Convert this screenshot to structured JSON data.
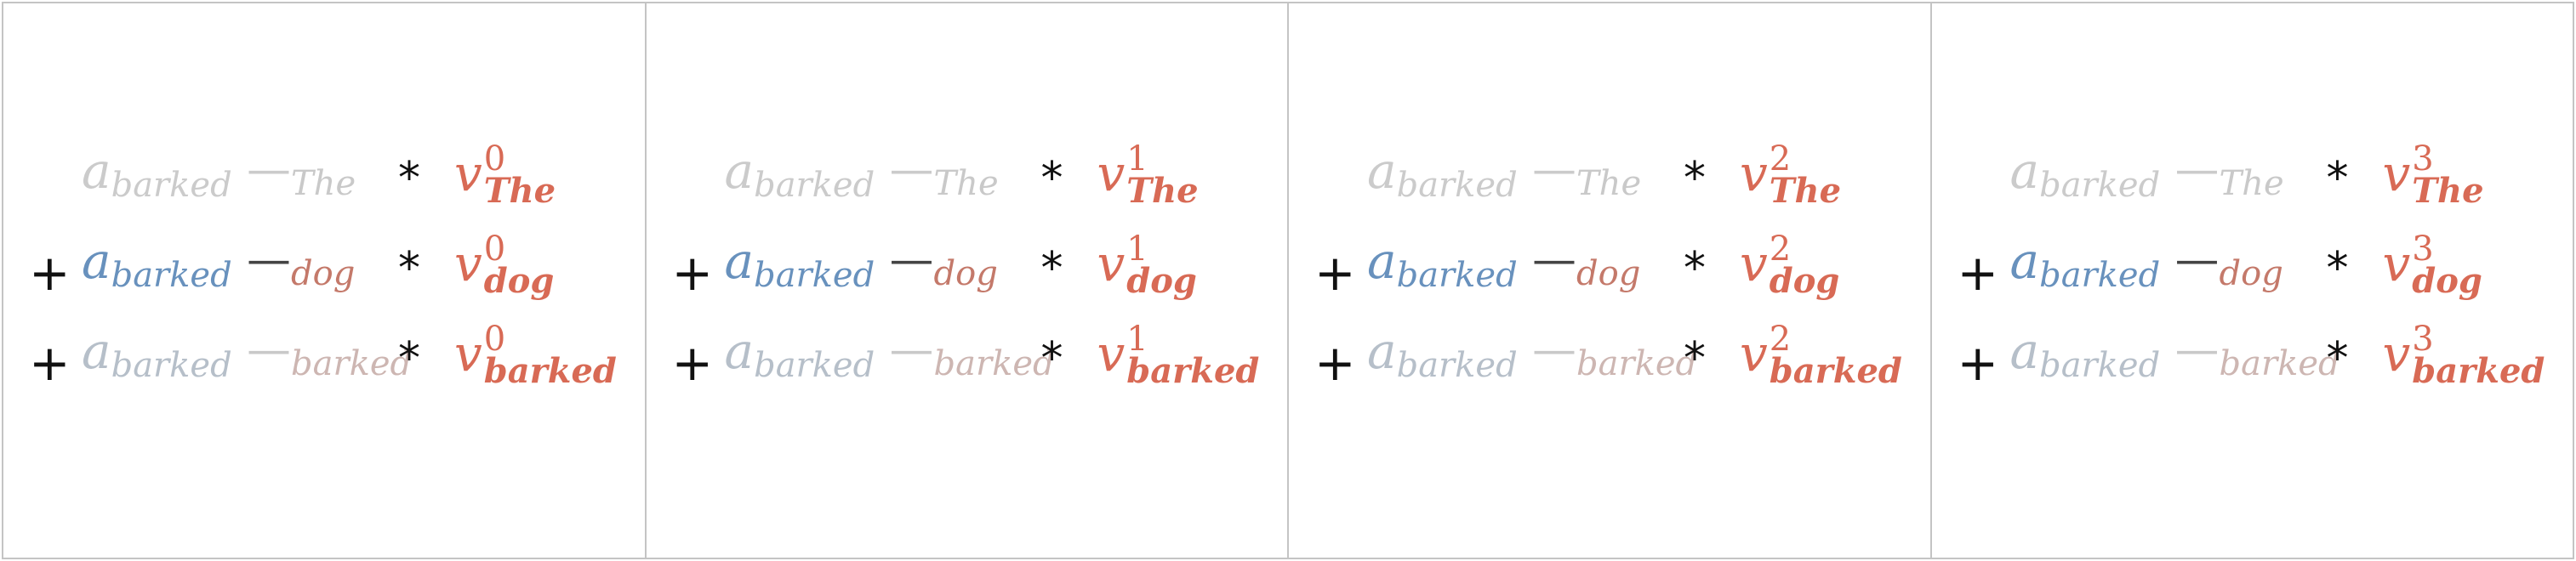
{
  "symbols": {
    "plus": "+",
    "times": "*",
    "minus": "—",
    "attention_base": "a",
    "value_base": "v"
  },
  "query": "barked",
  "panels": [
    {
      "index": "0",
      "rows": [
        {
          "lead": "",
          "a_sub": "barked",
          "key": "The",
          "v_sup": "0",
          "v_sub": "The"
        },
        {
          "lead": "+",
          "a_sub": "barked",
          "key": "dog",
          "v_sup": "0",
          "v_sub": "dog"
        },
        {
          "lead": "+",
          "a_sub": "barked",
          "key": "barked",
          "v_sup": "0",
          "v_sub": "barked"
        }
      ]
    },
    {
      "index": "1",
      "rows": [
        {
          "lead": "",
          "a_sub": "barked",
          "key": "The",
          "v_sup": "1",
          "v_sub": "The"
        },
        {
          "lead": "+",
          "a_sub": "barked",
          "key": "dog",
          "v_sup": "1",
          "v_sub": "dog"
        },
        {
          "lead": "+",
          "a_sub": "barked",
          "key": "barked",
          "v_sup": "1",
          "v_sub": "barked"
        }
      ]
    },
    {
      "index": "2",
      "rows": [
        {
          "lead": "",
          "a_sub": "barked",
          "key": "The",
          "v_sup": "2",
          "v_sub": "The"
        },
        {
          "lead": "+",
          "a_sub": "barked",
          "key": "dog",
          "v_sup": "2",
          "v_sub": "dog"
        },
        {
          "lead": "+",
          "a_sub": "barked",
          "key": "barked",
          "v_sup": "2",
          "v_sub": "barked"
        }
      ]
    },
    {
      "index": "3",
      "rows": [
        {
          "lead": "",
          "a_sub": "barked",
          "key": "The",
          "v_sup": "3",
          "v_sub": "The"
        },
        {
          "lead": "+",
          "a_sub": "barked",
          "key": "dog",
          "v_sup": "3",
          "v_sub": "dog"
        },
        {
          "lead": "+",
          "a_sub": "barked",
          "key": "barked",
          "v_sup": "3",
          "v_sub": "barked"
        }
      ]
    }
  ],
  "colors": {
    "frame": "#c4c4c4",
    "value_vector": "#d86a55",
    "the_weight": "#cbcbcb",
    "dog_weight": "#6891bd",
    "dog_key": "#c4796a",
    "barked_weight": "#b6bfc9",
    "barked_key": "#cdb6b2"
  }
}
